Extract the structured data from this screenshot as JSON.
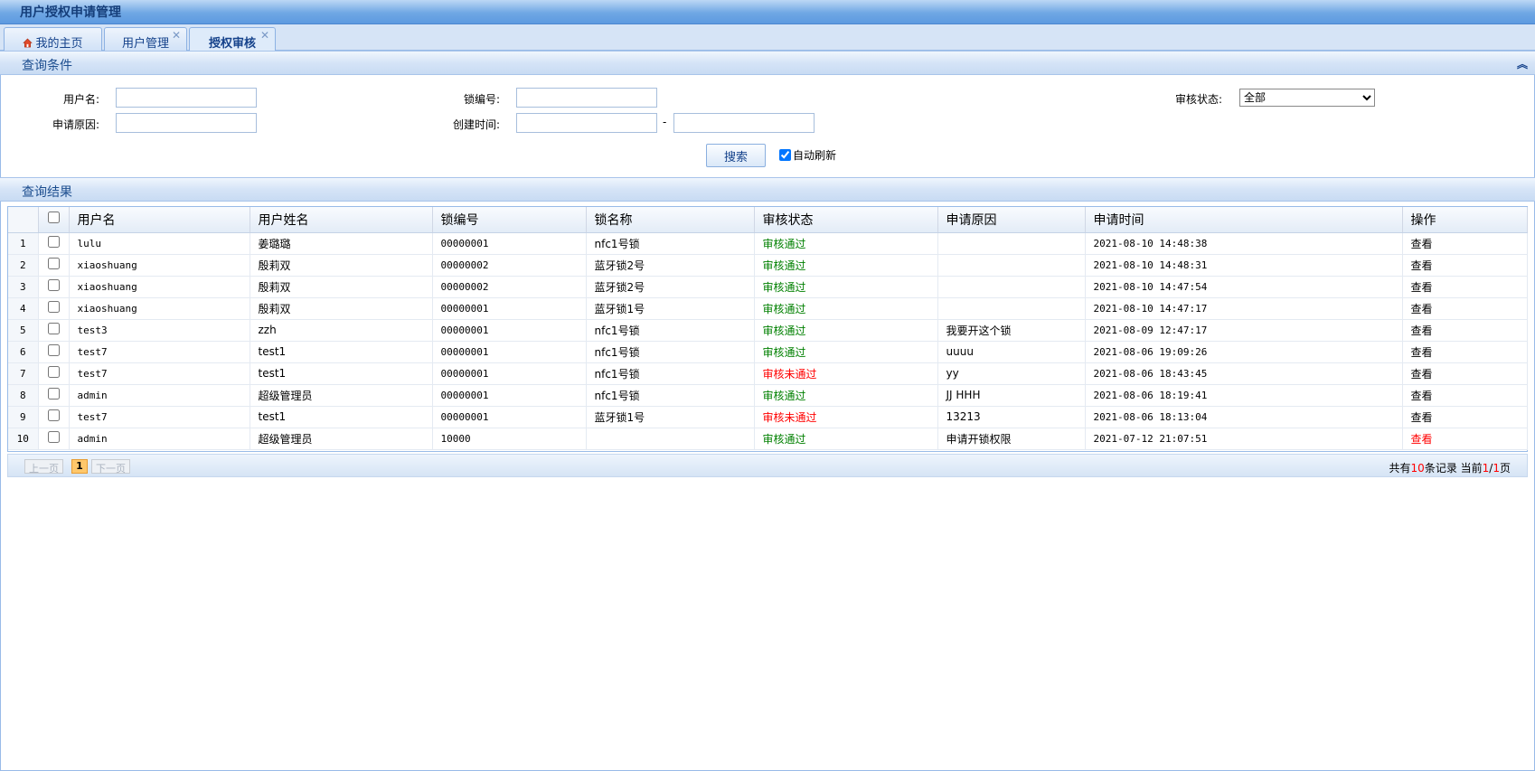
{
  "app": {
    "title": "用户授权申请管理"
  },
  "tabs": [
    {
      "label": "我的主页",
      "closable": false,
      "icon": "home-icon"
    },
    {
      "label": "用户管理",
      "closable": true
    },
    {
      "label": "授权审核",
      "closable": true,
      "active": true
    }
  ],
  "query": {
    "section_title": "查询条件",
    "username_label": "用户名:",
    "lock_no_label": "锁编号:",
    "status_label": "审核状态:",
    "status_value": "全部",
    "reason_label": "申请原因:",
    "created_label": "创建时间:",
    "date_sep": "-",
    "search_button": "搜索",
    "auto_refresh_label": "自动刷新",
    "auto_refresh_checked": true
  },
  "results": {
    "section_title": "查询结果",
    "columns": [
      "用户名",
      "用户姓名",
      "锁编号",
      "锁名称",
      "审核状态",
      "申请原因",
      "申请时间",
      "操作"
    ],
    "rows": [
      {
        "num": "1",
        "username": "lulu",
        "name": "姜璐璐",
        "lock_no": "00000001",
        "lock_name": "nfc1号锁",
        "status": "审核通过",
        "reason": "",
        "time": "2021-08-10 14:48:38",
        "action": "查看"
      },
      {
        "num": "2",
        "username": "xiaoshuang",
        "name": "殷莉双",
        "lock_no": "00000002",
        "lock_name": "蓝牙锁2号",
        "status": "审核通过",
        "reason": "",
        "time": "2021-08-10 14:48:31",
        "action": "查看"
      },
      {
        "num": "3",
        "username": "xiaoshuang",
        "name": "殷莉双",
        "lock_no": "00000002",
        "lock_name": "蓝牙锁2号",
        "status": "审核通过",
        "reason": "",
        "time": "2021-08-10 14:47:54",
        "action": "查看"
      },
      {
        "num": "4",
        "username": "xiaoshuang",
        "name": "殷莉双",
        "lock_no": "00000001",
        "lock_name": "蓝牙锁1号",
        "status": "审核通过",
        "reason": "",
        "time": "2021-08-10 14:47:17",
        "action": "查看"
      },
      {
        "num": "5",
        "username": "test3",
        "name": "zzh",
        "lock_no": "00000001",
        "lock_name": "nfc1号锁",
        "status": "审核通过",
        "reason": "我要开这个锁",
        "time": "2021-08-09 12:47:17",
        "action": "查看"
      },
      {
        "num": "6",
        "username": "test7",
        "name": "test1",
        "lock_no": "00000001",
        "lock_name": "nfc1号锁",
        "status": "审核通过",
        "reason": "uuuu",
        "time": "2021-08-06 19:09:26",
        "action": "查看"
      },
      {
        "num": "7",
        "username": "test7",
        "name": "test1",
        "lock_no": "00000001",
        "lock_name": "nfc1号锁",
        "status": "审核未通过",
        "reason": "yy",
        "time": "2021-08-06 18:43:45",
        "action": "查看"
      },
      {
        "num": "8",
        "username": "admin",
        "name": "超级管理员",
        "lock_no": "00000001",
        "lock_name": "nfc1号锁",
        "status": "审核通过",
        "reason": "JJ HHH",
        "time": "2021-08-06 18:19:41",
        "action": "查看"
      },
      {
        "num": "9",
        "username": "test7",
        "name": "test1",
        "lock_no": "00000001",
        "lock_name": "蓝牙锁1号",
        "status": "审核未通过",
        "reason": "13213",
        "time": "2021-08-06 18:13:04",
        "action": "查看"
      },
      {
        "num": "10",
        "username": "admin",
        "name": "超级管理员",
        "lock_no": "10000",
        "lock_name": "",
        "status": "审核通过",
        "reason": "申请开锁权限",
        "time": "2021-07-12 21:07:51",
        "action": "查看",
        "action_highlight": true
      }
    ]
  },
  "pager": {
    "prev": "上一页",
    "page": "1",
    "next": "下一页",
    "summary_prefix": "共有",
    "total": "10",
    "summary_mid": "条记录 当前",
    "current": "1",
    "slash": "/",
    "pages": "1",
    "summary_suffix": "页"
  },
  "colors": {
    "pass": "#008000",
    "fail": "#ff0000",
    "header": "#5d9ae0"
  }
}
